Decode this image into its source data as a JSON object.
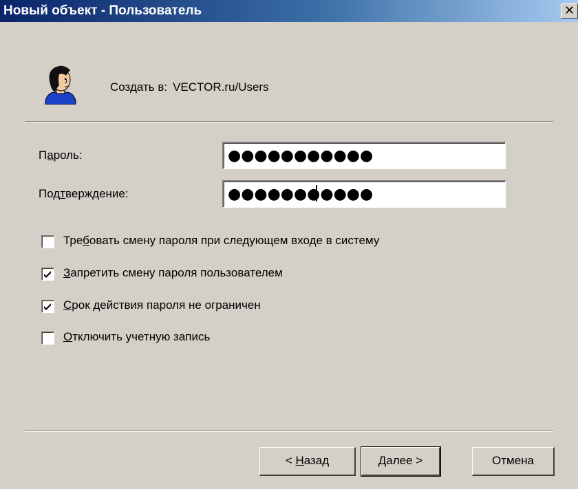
{
  "window": {
    "title": "Новый объект - Пользователь",
    "close_glyph": "✕"
  },
  "header": {
    "create_in_label": "Создать в:",
    "create_in_path": "VECTOR.ru/Users",
    "icon": "user-icon"
  },
  "form": {
    "password_label_prefix": "П",
    "password_label_accel": "а",
    "password_label_suffix": "роль:",
    "password_value": "●●●●●●●●●●●",
    "confirm_label_prefix": "Под",
    "confirm_label_accel": "т",
    "confirm_label_suffix": "верждение:",
    "confirm_value": "●●●●●●●●●●●"
  },
  "options": [
    {
      "prefix": "Тре",
      "accel": "б",
      "suffix": "овать смену пароля при следующем входе в систему",
      "checked": false
    },
    {
      "prefix": "",
      "accel": "З",
      "suffix": "апретить смену пароля пользователем",
      "checked": true
    },
    {
      "prefix": "",
      "accel": "С",
      "suffix": "рок действия пароля не ограничен",
      "checked": true
    },
    {
      "prefix": "",
      "accel": "О",
      "suffix": "тключить учетную запись",
      "checked": false
    }
  ],
  "buttons": {
    "back_prefix": "< ",
    "back_accel": "Н",
    "back_suffix": "азад",
    "next_accel": "Д",
    "next_suffix": "алее >",
    "cancel": "Отмена"
  },
  "colors": {
    "title_start": "#0a246a",
    "title_end": "#a6caf0",
    "dialog_bg": "#d4d0c8"
  }
}
